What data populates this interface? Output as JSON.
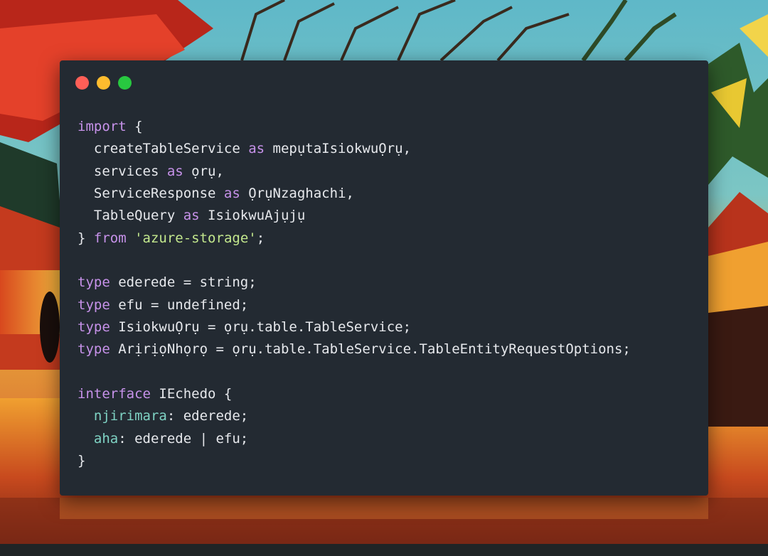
{
  "window": {
    "controls": [
      "close",
      "minimize",
      "maximize"
    ],
    "colors": {
      "close": "#ff5f57",
      "minimize": "#febc2e",
      "maximize": "#28c840",
      "background": "#232a32"
    }
  },
  "code": {
    "lines": [
      [
        {
          "t": "import",
          "c": "kw"
        },
        {
          "t": " {",
          "c": "pl"
        }
      ],
      [
        {
          "t": "  createTableService ",
          "c": "pl"
        },
        {
          "t": "as",
          "c": "kw"
        },
        {
          "t": " mepụtaIsiokwuỌrụ,",
          "c": "pl"
        }
      ],
      [
        {
          "t": "  services ",
          "c": "pl"
        },
        {
          "t": "as",
          "c": "kw"
        },
        {
          "t": " ọrụ,",
          "c": "pl"
        }
      ],
      [
        {
          "t": "  ServiceResponse ",
          "c": "pl"
        },
        {
          "t": "as",
          "c": "kw"
        },
        {
          "t": " ỌrụNzaghachi,",
          "c": "pl"
        }
      ],
      [
        {
          "t": "  TableQuery ",
          "c": "pl"
        },
        {
          "t": "as",
          "c": "kw"
        },
        {
          "t": " IsiokwuAjụjụ",
          "c": "pl"
        }
      ],
      [
        {
          "t": "} ",
          "c": "pl"
        },
        {
          "t": "from",
          "c": "kw"
        },
        {
          "t": " ",
          "c": "pl"
        },
        {
          "t": "'azure-storage'",
          "c": "str"
        },
        {
          "t": ";",
          "c": "pl"
        }
      ],
      [],
      [
        {
          "t": "type",
          "c": "kw"
        },
        {
          "t": " ederede = string;",
          "c": "pl"
        }
      ],
      [
        {
          "t": "type",
          "c": "kw"
        },
        {
          "t": " efu = undefined;",
          "c": "pl"
        }
      ],
      [
        {
          "t": "type",
          "c": "kw"
        },
        {
          "t": " IsiokwuỌrụ = ọrụ.table.TableService;",
          "c": "pl"
        }
      ],
      [
        {
          "t": "type",
          "c": "kw"
        },
        {
          "t": " ArịrịọNhọrọ = ọrụ.table.TableService.TableEntityRequestOptions;",
          "c": "pl"
        }
      ],
      [],
      [
        {
          "t": "interface",
          "c": "kw"
        },
        {
          "t": " IEchedo {",
          "c": "pl"
        }
      ],
      [
        {
          "t": "  ",
          "c": "pl"
        },
        {
          "t": "njirimara",
          "c": "prop"
        },
        {
          "t": ": ederede;",
          "c": "pl"
        }
      ],
      [
        {
          "t": "  ",
          "c": "pl"
        },
        {
          "t": "aha",
          "c": "prop"
        },
        {
          "t": ": ederede | efu;",
          "c": "pl"
        }
      ],
      [
        {
          "t": "}",
          "c": "pl"
        }
      ]
    ]
  },
  "syntax_colors": {
    "keyword": "#c792ea",
    "string": "#c3e88d",
    "property": "#7fd3c4",
    "plain": "#e6e8ec"
  }
}
